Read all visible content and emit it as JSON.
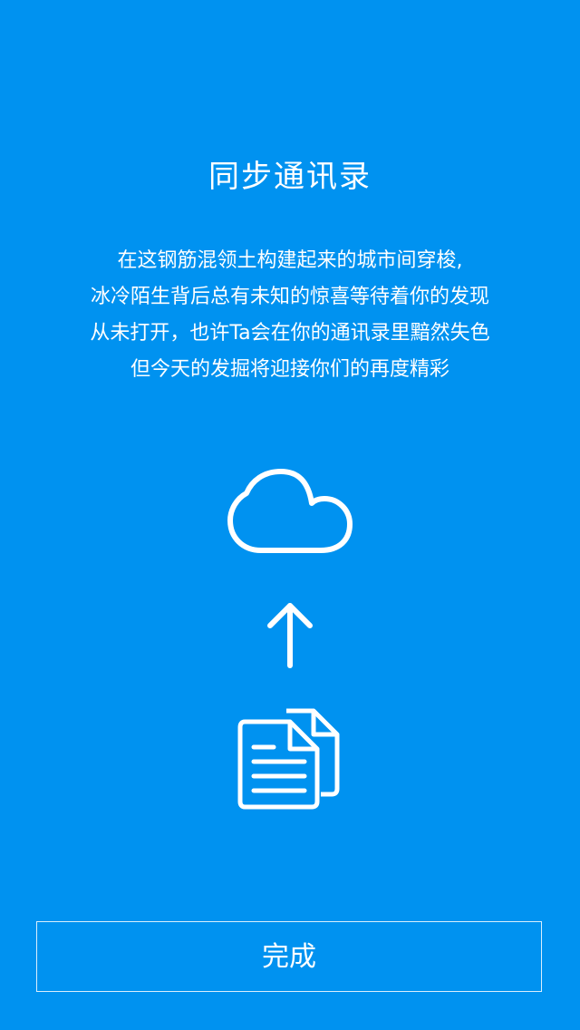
{
  "page": {
    "background_color": "#0092F0",
    "title": "同步通讯录",
    "description_lines": [
      "在这钢筋混领土构建起来的城市间穿梭,",
      "冰冷陌生背后总有未知的惊喜等待着你的发现",
      "从未打开，也许Ta会在你的通讯录里黯然失色",
      "但今天的发掘将迎接你们的再度精彩"
    ]
  },
  "icons": {
    "cloud": "cloud-icon",
    "arrow": "arrow-up-icon",
    "documents": "documents-icon"
  },
  "actions": {
    "done_label": "完成"
  }
}
